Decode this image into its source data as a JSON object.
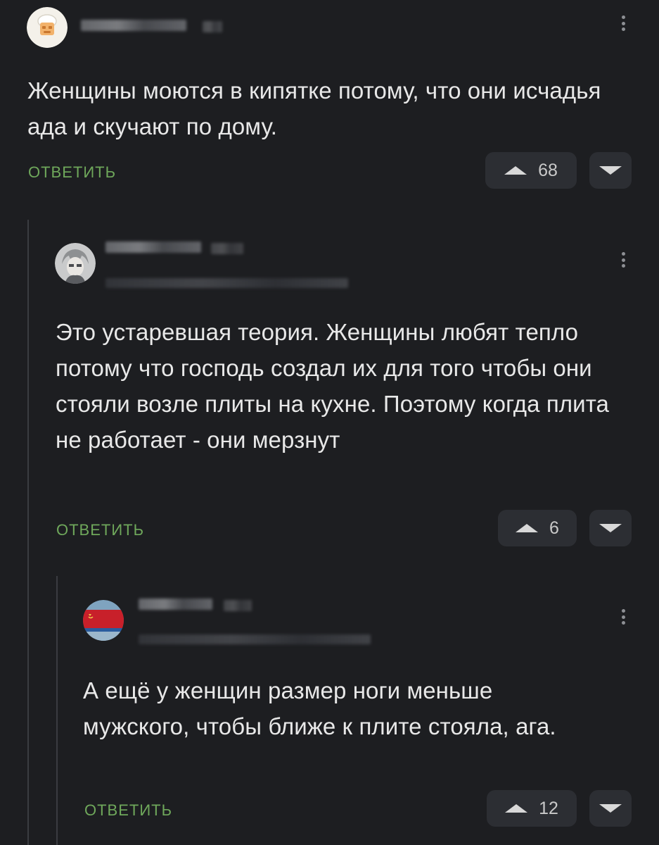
{
  "comments": [
    {
      "text": "Женщины моются в кипятке потому, что они исчадья ада и скучают по дому.",
      "reply_label": "ОТВЕТИТЬ",
      "rating": "68",
      "avatar_icon": "chef-avatar-icon"
    },
    {
      "text": "Это устаревшая теория. Женщины любят тепло потому что господь создал их для того чтобы они стояли возле плиты на кухне. Поэтому когда плита не работает - они мерзнут",
      "reply_label": "ОТВЕТИТЬ",
      "rating": "6",
      "avatar_icon": "anime-character-avatar-icon"
    },
    {
      "text": "А ещё у женщин размер ноги меньше мужского, чтобы ближе к плите стояла, ага.",
      "reply_label": "ОТВЕТИТЬ",
      "rating": "12",
      "avatar_icon": "flag-avatar-icon"
    }
  ],
  "colors": {
    "background": "#1d1e21",
    "reply_link": "#6fa85b",
    "vote_button": "#2c2e33",
    "thread_line": "#3a3c41"
  }
}
